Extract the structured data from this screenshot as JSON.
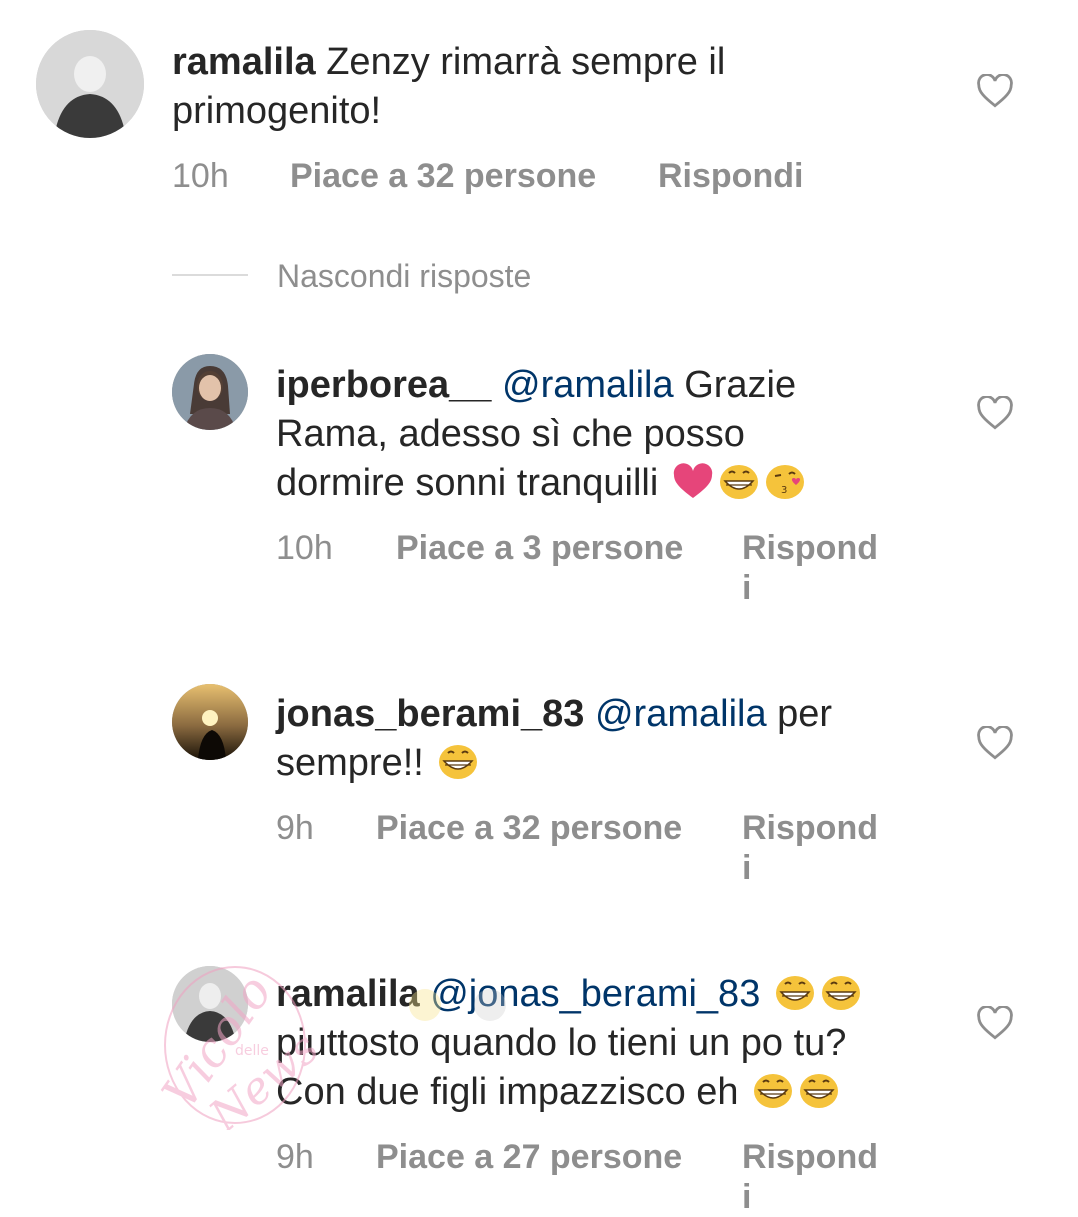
{
  "hide_replies_label": "Nascondi risposte",
  "watermark_text": "Vicolo delle News",
  "colors": {
    "username": "#262626",
    "mention": "#003569",
    "meta": "#8e8e8e",
    "heart_stroke": "#8e8e8e",
    "emoji_heart": "#e6457a"
  },
  "comments": [
    {
      "username": "ramalila",
      "mention": "",
      "text_line1": "Zenzy rimarrà sempre il",
      "text_line2": "primogenito!",
      "time": "10h",
      "likes": "Piace a 32 persone",
      "reply": "Rispondi"
    },
    {
      "username": "iperborea__",
      "mention": "@ramalila",
      "text_line1": "Grazie",
      "text_line2": "Rama, adesso sì che posso",
      "text_line3": "dormire sonni tranquilli",
      "emojis": [
        "heart-emoji",
        "grinning-emoji",
        "kiss-emoji"
      ],
      "time": "10h",
      "likes": "Piace a 3 persone",
      "reply_line1": "Rispond",
      "reply_line2": "i"
    },
    {
      "username": "jonas_berami_83",
      "mention": "@ramalila",
      "text_line1": "per",
      "text_line2": "sempre!!",
      "emojis": [
        "grinning-emoji"
      ],
      "time": "9h",
      "likes": "Piace a 32 persone",
      "reply_line1": "Rispond",
      "reply_line2": "i"
    },
    {
      "username": "ramalila",
      "mention": "@jonas_berami_83",
      "text_line2": "piuttosto quando lo tieni un po tu?",
      "text_line3": "Con due figli impazzisco eh",
      "emojis": [
        "grinning-emoji",
        "grinning-emoji",
        "grinning-emoji",
        "grinning-emoji"
      ],
      "time": "9h",
      "likes": "Piace a 27 persone",
      "reply_line1": "Rispond",
      "reply_line2": "i"
    }
  ]
}
